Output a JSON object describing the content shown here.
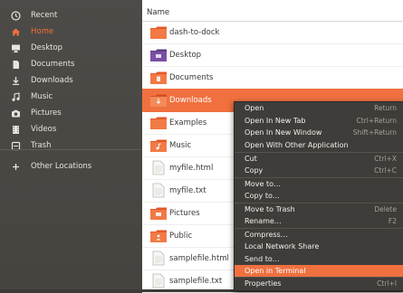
{
  "sidebar": {
    "items": [
      {
        "label": "Recent",
        "icon": "clock-icon"
      },
      {
        "label": "Home",
        "icon": "home-icon",
        "active": true
      },
      {
        "label": "Desktop",
        "icon": "desktop-icon"
      },
      {
        "label": "Documents",
        "icon": "document-icon"
      },
      {
        "label": "Downloads",
        "icon": "download-icon"
      },
      {
        "label": "Music",
        "icon": "music-icon"
      },
      {
        "label": "Pictures",
        "icon": "camera-icon"
      },
      {
        "label": "Videos",
        "icon": "video-icon"
      },
      {
        "label": "Trash",
        "icon": "trash-icon"
      },
      {
        "label": "Other Locations",
        "icon": "plus-icon"
      }
    ]
  },
  "files": {
    "column_header": "Name",
    "items": [
      {
        "name": "dash-to-dock",
        "kind": "folder"
      },
      {
        "name": "Desktop",
        "kind": "folder-desktop"
      },
      {
        "name": "Documents",
        "kind": "folder-documents"
      },
      {
        "name": "Downloads",
        "kind": "folder-downloads",
        "selected": true
      },
      {
        "name": "Examples",
        "kind": "folder-examples"
      },
      {
        "name": "Music",
        "kind": "folder-music"
      },
      {
        "name": "myfile.html",
        "kind": "file"
      },
      {
        "name": "myfile.txt",
        "kind": "file"
      },
      {
        "name": "Pictures",
        "kind": "folder-pictures"
      },
      {
        "name": "Public",
        "kind": "folder-public"
      },
      {
        "name": "samplefile.html",
        "kind": "file"
      },
      {
        "name": "samplefile.txt",
        "kind": "file"
      }
    ]
  },
  "context_menu": {
    "items": [
      {
        "label": "Open",
        "shortcut": "Return"
      },
      {
        "label": "Open In New Tab",
        "shortcut": "Ctrl+Return"
      },
      {
        "label": "Open In New Window",
        "shortcut": "Shift+Return"
      },
      {
        "label": "Open With Other Application",
        "shortcut": ""
      },
      {
        "label": "Cut",
        "shortcut": "Ctrl+X"
      },
      {
        "label": "Copy",
        "shortcut": "Ctrl+C"
      },
      {
        "label": "Move to…",
        "shortcut": ""
      },
      {
        "label": "Copy to…",
        "shortcut": ""
      },
      {
        "label": "Move to Trash",
        "shortcut": "Delete"
      },
      {
        "label": "Rename…",
        "shortcut": "F2"
      },
      {
        "label": "Compress…",
        "shortcut": ""
      },
      {
        "label": "Local Network Share",
        "shortcut": ""
      },
      {
        "label": "Send to…",
        "shortcut": ""
      },
      {
        "label": "Open in Terminal",
        "shortcut": "",
        "highlighted": true
      },
      {
        "label": "Properties",
        "shortcut": "Ctrl+I"
      }
    ]
  },
  "colors": {
    "accent": "#f0703f",
    "sidebar_bg": "#4c4a46",
    "menu_bg": "#3e3d39"
  }
}
